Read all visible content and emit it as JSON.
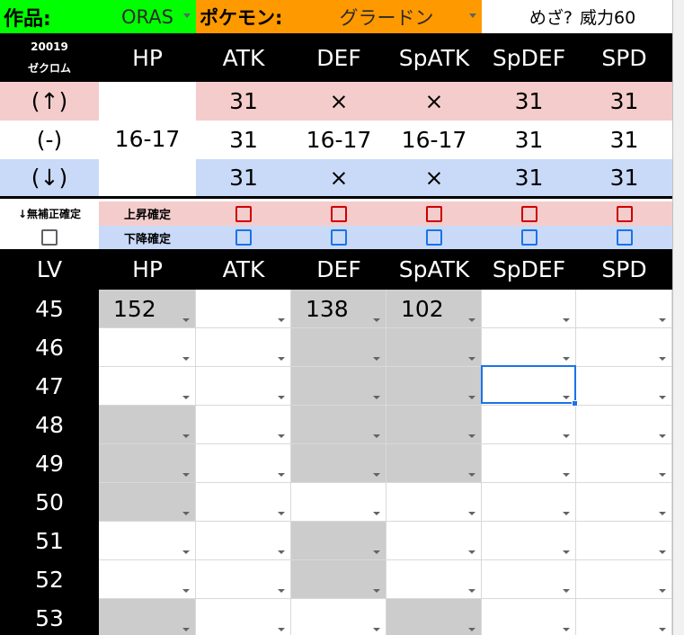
{
  "top_bar": {
    "game_label": "作品:",
    "game_value": "ORAS",
    "pokemon_label": "ポケモン:",
    "pokemon_value": "グラードン",
    "hidden_power_label": "めざ?",
    "hidden_power_value": "威力60"
  },
  "id_block": {
    "number": "20019",
    "name": "ゼクロム"
  },
  "stat_headers": [
    "HP",
    "ATK",
    "DEF",
    "SpATK",
    "SpDEF",
    "SPD"
  ],
  "nature_rows": {
    "up_label": "(↑)",
    "neutral_label": "(-)",
    "down_label": "(↓)",
    "hp_range": "16-17",
    "up_values": [
      "31",
      "×",
      "×",
      "31",
      "31"
    ],
    "neutral_values": [
      "31",
      "16-17",
      "16-17",
      "31",
      "31"
    ],
    "down_values": [
      "31",
      "×",
      "×",
      "31",
      "31"
    ]
  },
  "confirm": {
    "no_nature_label": "↓無補正確定",
    "up_label": "上昇確定",
    "down_label": "下降確定"
  },
  "level_header": "LV",
  "levels": [
    {
      "lv": "45",
      "values": [
        "152",
        "",
        "138",
        "102",
        "",
        ""
      ]
    },
    {
      "lv": "46",
      "values": [
        "",
        "",
        "",
        "",
        "",
        ""
      ]
    },
    {
      "lv": "47",
      "values": [
        "",
        "",
        "",
        "",
        "",
        ""
      ]
    },
    {
      "lv": "48",
      "values": [
        "",
        "",
        "",
        "",
        "",
        ""
      ]
    },
    {
      "lv": "49",
      "values": [
        "",
        "",
        "",
        "",
        "",
        ""
      ]
    },
    {
      "lv": "50",
      "values": [
        "",
        "",
        "",
        "",
        "",
        ""
      ]
    },
    {
      "lv": "51",
      "values": [
        "",
        "",
        "",
        "",
        "",
        ""
      ]
    },
    {
      "lv": "52",
      "values": [
        "",
        "",
        "",
        "",
        "",
        ""
      ]
    },
    {
      "lv": "53",
      "values": [
        "",
        "",
        "",
        "",
        "",
        ""
      ]
    }
  ],
  "colors": {
    "game_label_bg": "#00ff00",
    "pokemon_label_bg": "#ff9900",
    "pokemon_value_bg": "#ff9900",
    "up_row": "#f4cccc",
    "down_row": "#c9daf8",
    "shaded_cell": "#cccccc",
    "selection": "#1a73e8"
  }
}
